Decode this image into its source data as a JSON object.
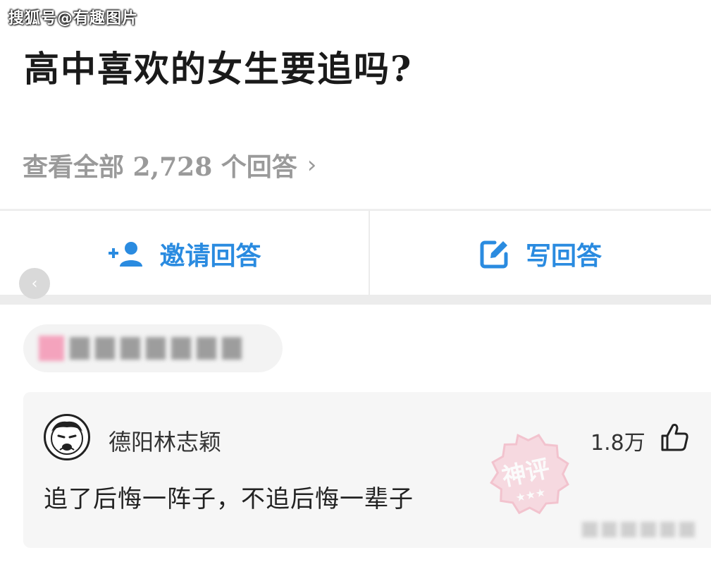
{
  "watermark": "搜狐号@有趣图片",
  "question": {
    "title": "高中喜欢的女生要追吗?",
    "view_all_label": "查看全部 2,728 个回答",
    "chevron_icon": "chevron-right-icon"
  },
  "actions": {
    "invite_label": "邀请回答",
    "invite_icon": "add-person-icon",
    "write_label": "写回答",
    "write_icon": "edit-icon"
  },
  "back_icon": "chevron-left-icon",
  "comment": {
    "username": "德阳林志颖",
    "likes": "1.8万",
    "like_icon": "thumbs-up-icon",
    "text": "追了后悔一阵子，不追后悔一辈子",
    "stamp_text": "神评",
    "stamp_stars": "★★★"
  },
  "colors": {
    "accent": "#2a8be0",
    "stamp": "#f1a2b4",
    "title": "#1a1a1a",
    "muted": "#9a9a9a"
  }
}
